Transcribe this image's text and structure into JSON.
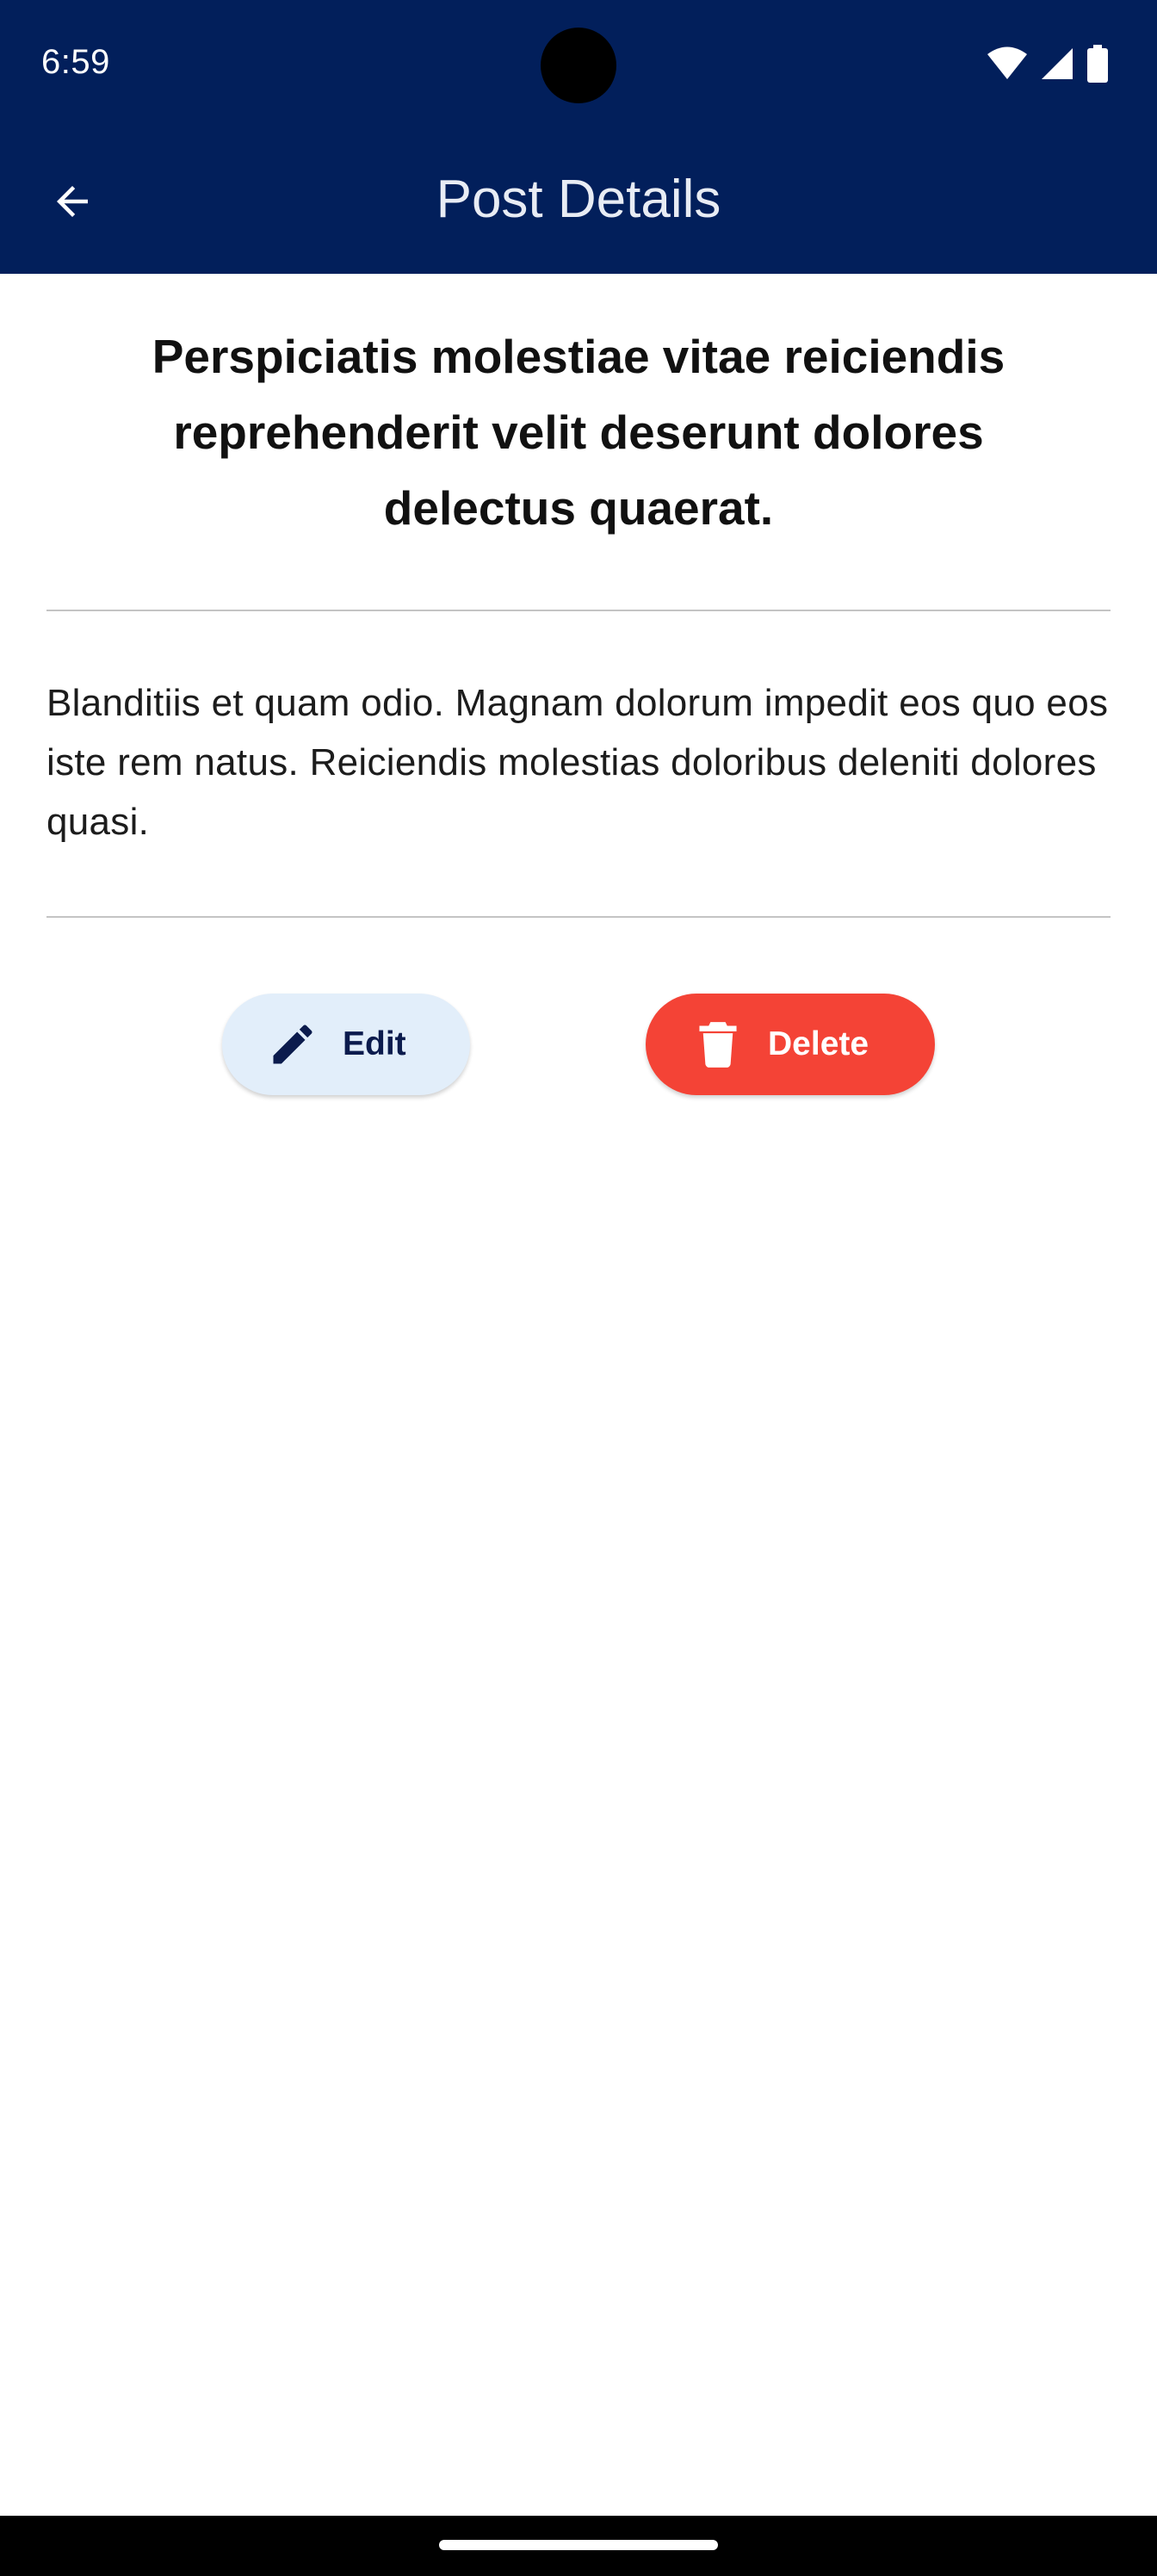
{
  "status_bar": {
    "time": "6:59",
    "icons": [
      "wifi-icon",
      "signal-icon",
      "battery-icon"
    ]
  },
  "app_bar": {
    "title": "Post Details",
    "back_icon": "arrow-back-icon"
  },
  "post": {
    "title": "Perspiciatis molestiae vitae reiciendis reprehenderit velit deserunt dolores delectus quaerat.",
    "body": "Blanditiis et quam odio. Magnam dolorum impedit eos quo eos iste rem natus. Reiciendis molestias doloribus deleniti dolores quasi."
  },
  "actions": {
    "edit": {
      "label": "Edit",
      "icon": "pencil-icon"
    },
    "delete": {
      "label": "Delete",
      "icon": "trash-icon"
    }
  },
  "colors": {
    "app_bar": "#021f5b",
    "edit_button": "#e2eefa",
    "delete_button": "#f44336"
  }
}
